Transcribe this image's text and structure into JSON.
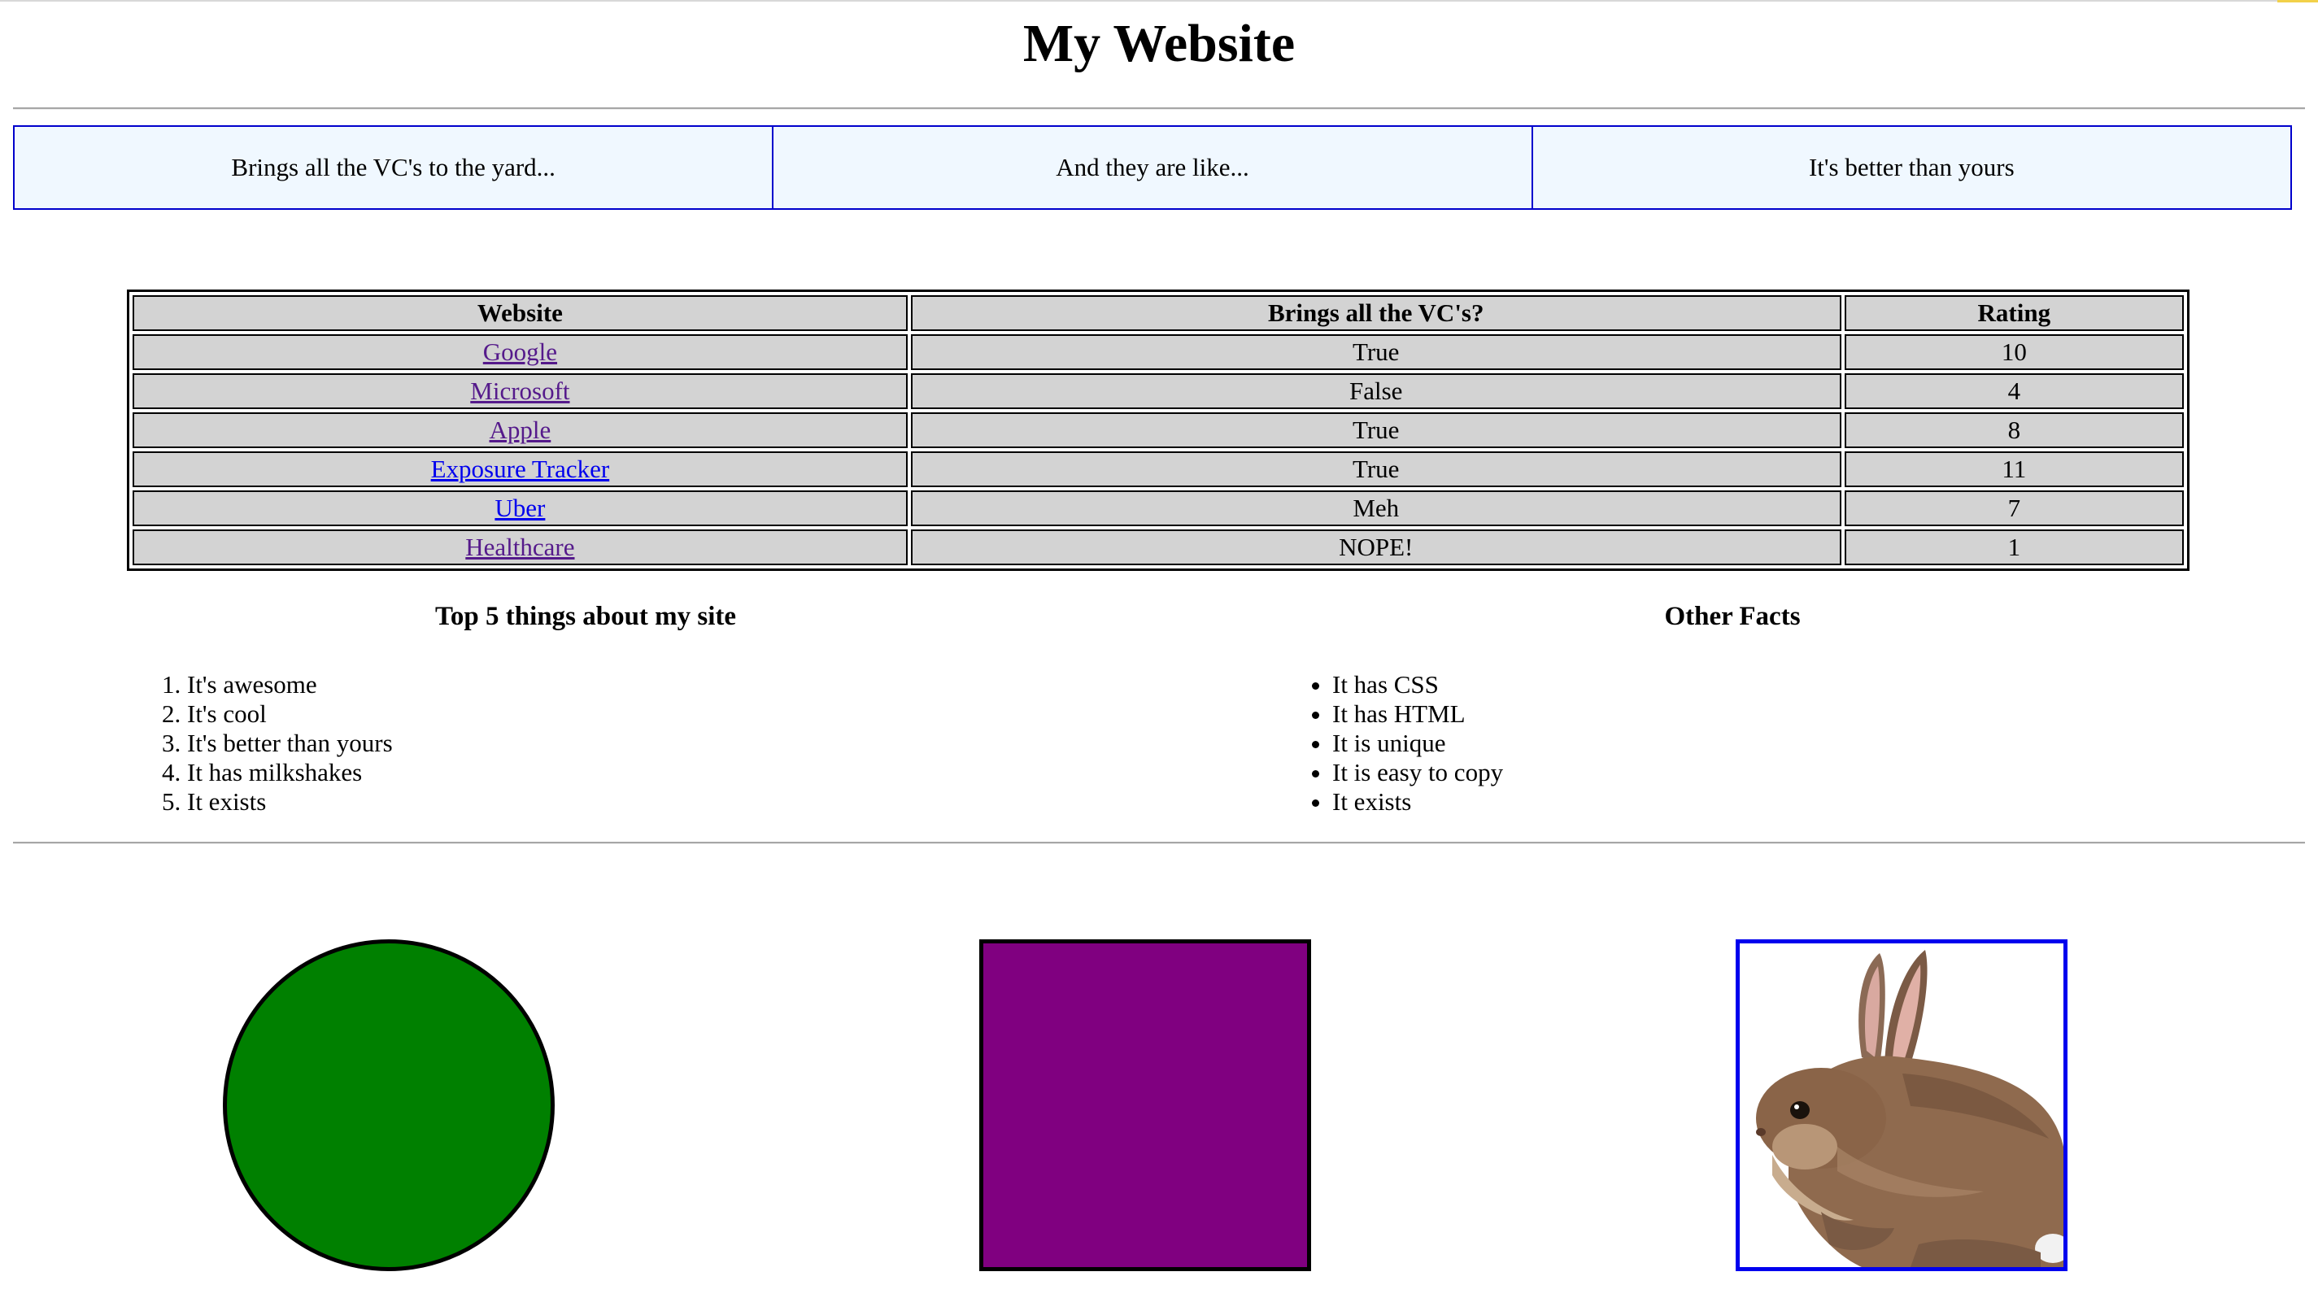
{
  "page": {
    "title": "My Website"
  },
  "banner": [
    "Brings all the VC's to the yard...",
    "And they are like...",
    "It's better than yours"
  ],
  "table": {
    "headers": [
      "Website",
      "Brings all the VC's?",
      "Rating"
    ],
    "rows": [
      {
        "website": "Google",
        "vcs": "True",
        "rating": "10",
        "link_state": "visited"
      },
      {
        "website": "Microsoft",
        "vcs": "False",
        "rating": "4",
        "link_state": "visited"
      },
      {
        "website": "Apple",
        "vcs": "True",
        "rating": "8",
        "link_state": "visited"
      },
      {
        "website": "Exposure Tracker",
        "vcs": "True",
        "rating": "11",
        "link_state": "unvisited"
      },
      {
        "website": "Uber",
        "vcs": "Meh",
        "rating": "7",
        "link_state": "unvisited"
      },
      {
        "website": "Healthcare",
        "vcs": "NOPE!",
        "rating": "1",
        "link_state": "visited"
      }
    ]
  },
  "top_list": {
    "heading": "Top 5 things about my site",
    "items": [
      "It's awesome",
      "It's cool",
      "It's better than yours",
      "It has milkshakes",
      "It exists"
    ]
  },
  "other_facts": {
    "heading": "Other Facts",
    "items": [
      "It has CSS",
      "It has HTML",
      "It is unique",
      "It is easy to copy",
      "It exists"
    ]
  },
  "shapes": {
    "circle_color": "#008000",
    "square_color": "#800080",
    "image_border_color": "#0000ee"
  },
  "colors": {
    "banner_bg": "#f0f8ff",
    "banner_border": "#0000cc",
    "table_cell_bg": "#d3d3d3",
    "link_visited": "#551a8b",
    "link_unvisited": "#0000ee"
  }
}
